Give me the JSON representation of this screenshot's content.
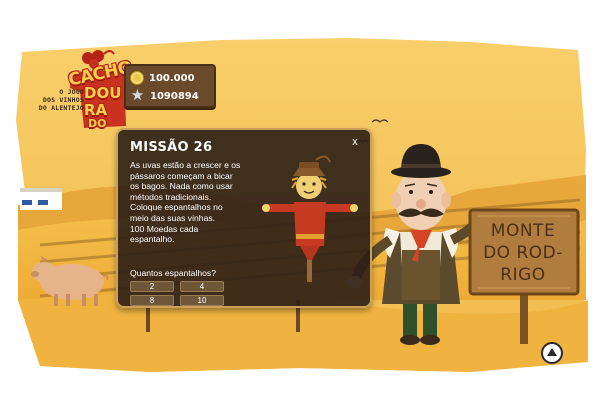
{
  "logo": {
    "word_cacho": "CACHO",
    "word_dou": "DOU",
    "word_ra": "RA",
    "word_do": "DO",
    "tagline": [
      "O JOGO",
      "DOS VINHOS",
      "DO ALENTEJO"
    ]
  },
  "stats": {
    "coins": "100.000",
    "xp": "1090894"
  },
  "mission": {
    "title": "MISSÃO 26",
    "close_label": "x",
    "body_lines": [
      "As uvas estão a crescer e os",
      "pássaros começam a bicar",
      "os bagos. Nada como usar",
      "métodos tradicionais.",
      "Coloque espantalhos no",
      "meio das suas vinhas.",
      "100 Moedas cada",
      "espantalho."
    ],
    "question": "Quantos espantalhos?",
    "options": [
      "2",
      "4",
      "8",
      "10"
    ]
  },
  "sign": {
    "lines": [
      "MONTE",
      "DO ROD-",
      "RIGO"
    ]
  },
  "colors": {
    "sky": "#f6c75f",
    "field": "#f2b63f",
    "dialog_bg": "#2b1e16",
    "sign_wood": "#a8783a",
    "logo_red": "#b52316",
    "logo_yellow": "#f7d04a"
  },
  "icons": {
    "coins": "coin-icon",
    "xp": "star-icon",
    "close": "close-icon",
    "scroll_up": "up-arrow-icon"
  }
}
